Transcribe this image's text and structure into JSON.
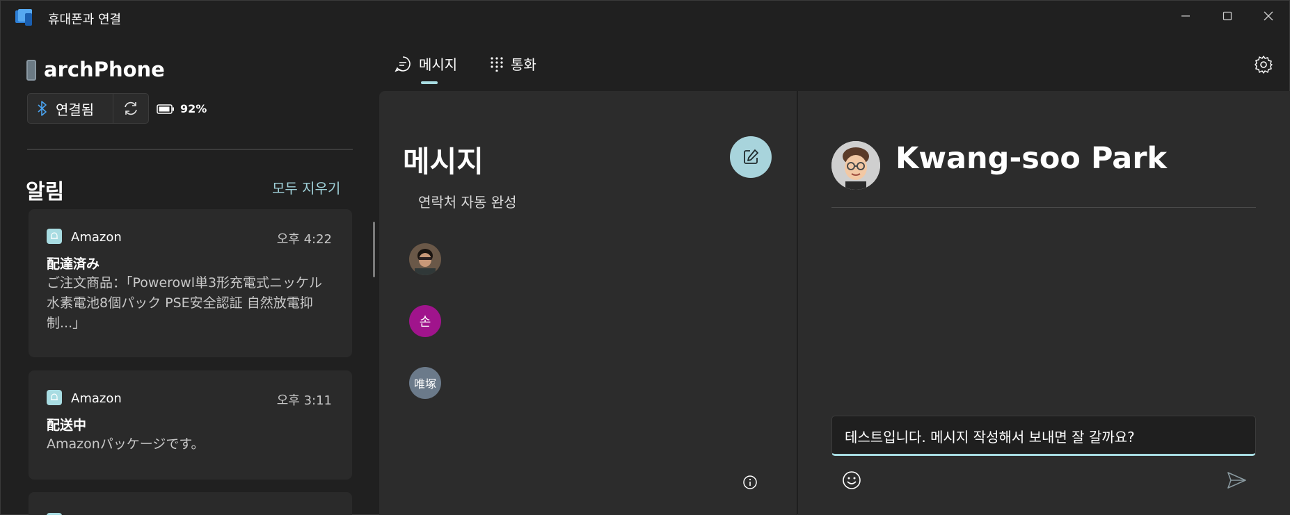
{
  "app": {
    "title": "휴대폰과 연결"
  },
  "window_controls": {
    "minimize": "—",
    "maximize": "☐",
    "close": "✕"
  },
  "phone": {
    "name": "archPhone",
    "connection_label": "연결됨",
    "battery": "92%"
  },
  "notifications": {
    "title": "알림",
    "clear_all": "모두 지우기",
    "items": [
      {
        "app": "Amazon",
        "time": "오후 4:22",
        "heading": "配達済み",
        "body": "ご注文商品：「Powerowl単3形充電式ニッケル水素電池8個パック PSE安全認証 自然放電抑制...」"
      },
      {
        "app": "Amazon",
        "time": "오후 3:11",
        "heading": "配送中",
        "body": "Amazonパッケージです。"
      }
    ]
  },
  "tabs": [
    {
      "label": "메시지",
      "icon": "chat-bubble-icon",
      "selected": true
    },
    {
      "label": "통화",
      "icon": "dialpad-icon",
      "selected": false
    }
  ],
  "messages": {
    "title": "메시지",
    "autocomplete": "연락처 자동 완성",
    "contacts": [
      {
        "initial": "",
        "type": "photo",
        "color": "#4a3a30"
      },
      {
        "initial": "손",
        "type": "initial",
        "color": "#a0148c"
      },
      {
        "initial": "唯塚",
        "type": "initial",
        "color": "#6b7a8a"
      }
    ]
  },
  "conversation": {
    "name": "Kwang-soo Park",
    "draft": "테스트입니다. 메시지 작성해서 보내면 잘 갈까요?"
  },
  "colors": {
    "accent": "#a8dce2",
    "background": "#202020",
    "panel": "#2c2c2c"
  }
}
